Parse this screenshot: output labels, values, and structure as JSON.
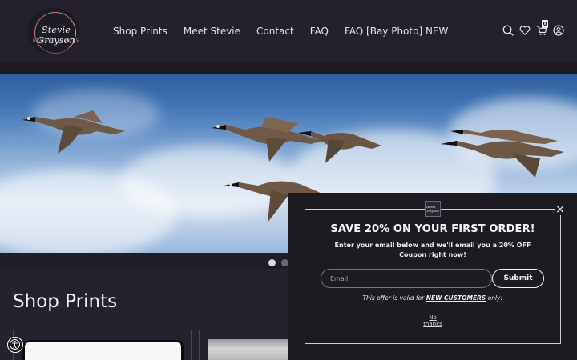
{
  "header": {
    "logo": {
      "script_text": "Stevie Grayson",
      "subtitle": "GRAYSON STUDIOS"
    },
    "nav": [
      "Shop Prints",
      "Meet Stevie",
      "Contact",
      "FAQ",
      "FAQ [Bay Photo] NEW"
    ],
    "icons": [
      "search-icon",
      "heart-icon",
      "cart-icon",
      "account-icon"
    ],
    "cart_count": "0"
  },
  "hero": {
    "image": "canada-geese-flying-in-blue-sky",
    "slides": 2,
    "active_slide": 1
  },
  "main": {
    "section_title": "Shop Prints"
  },
  "popup": {
    "logo_text": "Stevie Grayson",
    "close_label": "×",
    "title": "SAVE 20% ON YOUR FIRST ORDER!",
    "subtitle": "Enter your email below and we'll email you a 20% OFF Coupon right now!",
    "email_placeholder": "Email",
    "email_value": "",
    "submit_label": "Submit",
    "note_prefix": "This offer is valid for ",
    "note_bold": "NEW CUSTOMERS",
    "note_suffix": " only!",
    "no_thanks_line1": "No",
    "no_thanks_line2": "thanks"
  },
  "colors": {
    "background": "#25222e",
    "header": "#24212d",
    "popup": "#1d1b22",
    "accent_logo": "#c9727e",
    "text": "#e9e8ee"
  }
}
